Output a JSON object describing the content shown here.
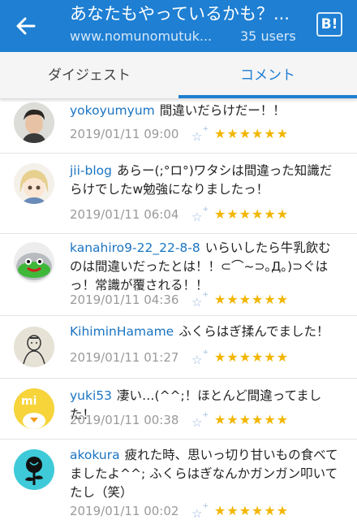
{
  "header": {
    "title": "あなたもやっているかも？...",
    "url": "www.nomunomutuk...",
    "users": "35 users",
    "bookmark_icon_label": "B!",
    "color": "#1e7fd3"
  },
  "tabs": [
    {
      "label": "ダイジェスト",
      "active": false
    },
    {
      "label": "コメント",
      "active": true
    }
  ],
  "comments": [
    {
      "user": "yokoyumyum",
      "text": "間違いだらけだー！！",
      "date": "2019/01/11 09:00",
      "stars": "★★★★★★",
      "avatar": "person-photo"
    },
    {
      "user": "jii-blog",
      "text": "あらー(;°ロ°)ワタシは間違った知識だらけでしたw勉強になりましたっ！",
      "date": "2019/01/11 06:04",
      "stars": "★★★★★★",
      "avatar": "anime-girl"
    },
    {
      "user": "kanahiro9-22_22-8-8",
      "text": "いらいしたら牛乳飲むのは間違いだったとは！！⊂⌒~⊃｡Д｡)⊃ぐはっ！常識が覆される！！",
      "date": "2019/01/11 04:36",
      "stars": "★★★★★★",
      "avatar": "green-blob"
    },
    {
      "user": "KihiminHamame",
      "text": "ふくらはぎ揉んでました！",
      "date": "2019/01/11 01:27",
      "stars": "★★★★★★",
      "avatar": "ink-drawing"
    },
    {
      "user": "yuki53",
      "text": "凄い…(^^;！ほとんど間違ってました！",
      "date": "2019/01/11 00:38",
      "stars": "★★★★★★",
      "avatar": "yellow-bird"
    },
    {
      "user": "akokura",
      "text": "疲れた時、思いっ切り甘いもの食べてましたよ^^; ふくらはぎなんかガンガン叩いてたし（笑）",
      "date": "2019/01/11 00:02",
      "stars": "★★★★★★",
      "avatar": "black-rose"
    }
  ],
  "add_star_label": "☆",
  "add_star_plus": "+"
}
